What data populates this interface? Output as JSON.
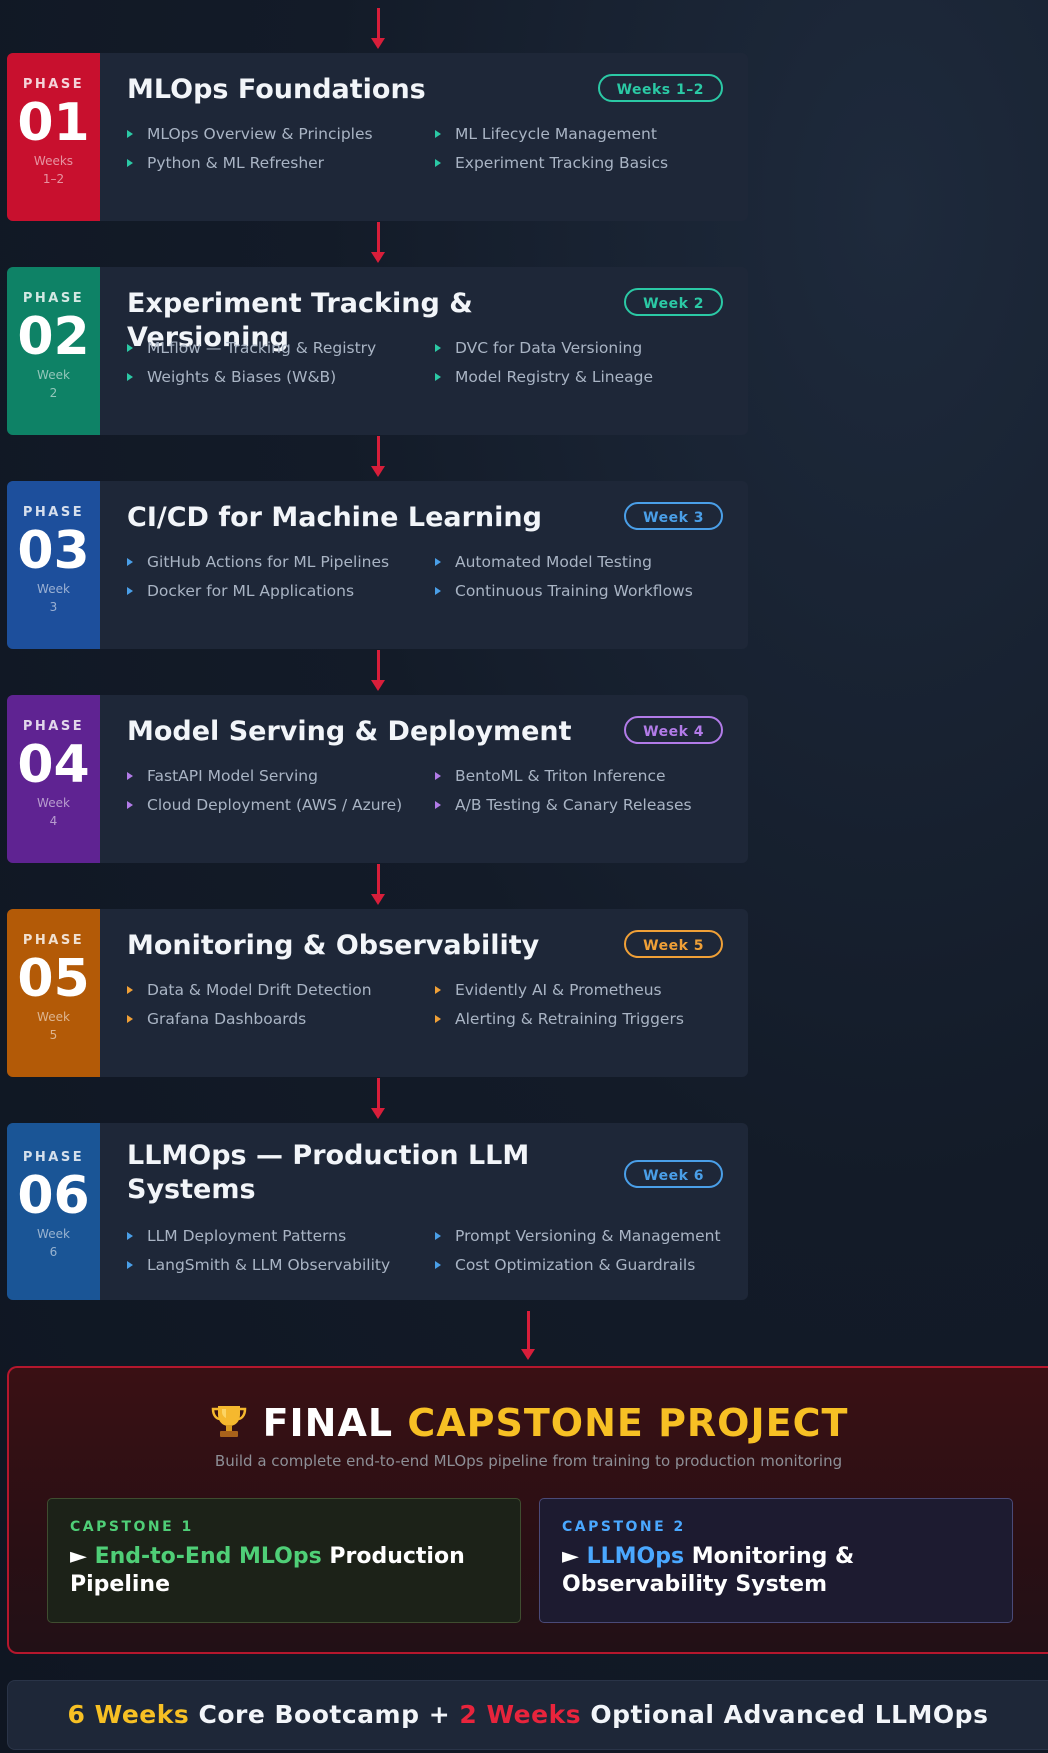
{
  "phases": [
    {
      "label": "PHASE",
      "number": "01",
      "side_week": "Weeks",
      "side_range": "1–2",
      "title": "MLOps Foundations",
      "badge": "Weeks 1–2",
      "color": "#c8102e",
      "accent": "#2bc9a5",
      "items": [
        "MLOps Overview & Principles",
        "ML Lifecycle Management",
        "Python & ML Refresher",
        "Experiment Tracking Basics"
      ]
    },
    {
      "label": "PHASE",
      "number": "02",
      "side_week": "Week",
      "side_range": "2",
      "title": "Experiment Tracking & Versioning",
      "badge": "Week 2",
      "color": "#0e8266",
      "accent": "#2bc9a5",
      "items": [
        "MLflow — Tracking & Registry",
        "DVC for Data Versioning",
        "Weights & Biases (W&B)",
        "Model Registry & Lineage"
      ]
    },
    {
      "label": "PHASE",
      "number": "03",
      "side_week": "Week",
      "side_range": "3",
      "title": "CI/CD for Machine Learning",
      "badge": "Week 3",
      "color": "#1d4f9c",
      "accent": "#4a9fe8",
      "items": [
        "GitHub Actions for ML Pipelines",
        "Automated Model Testing",
        "Docker for ML Applications",
        "Continuous Training Workflows"
      ]
    },
    {
      "label": "PHASE",
      "number": "04",
      "side_week": "Week",
      "side_range": "4",
      "title": "Model Serving & Deployment",
      "badge": "Week 4",
      "color": "#5f2392",
      "accent": "#b27be8",
      "items": [
        "FastAPI Model Serving",
        "BentoML & Triton Inference",
        "Cloud Deployment (AWS / Azure)",
        "A/B Testing & Canary Releases"
      ]
    },
    {
      "label": "PHASE",
      "number": "05",
      "side_week": "Week",
      "side_range": "5",
      "title": "Monitoring & Observability",
      "badge": "Week 5",
      "color": "#b35a07",
      "accent": "#f0a037",
      "items": [
        "Data & Model Drift Detection",
        "Evidently AI & Prometheus",
        "Grafana Dashboards",
        "Alerting & Retraining Triggers"
      ]
    },
    {
      "label": "PHASE",
      "number": "06",
      "side_week": "Week",
      "side_range": "6",
      "title": "LLMOps — Production LLM Systems",
      "badge": "Week 6",
      "color": "#1a5596",
      "accent": "#4a9fe8",
      "items": [
        "LLM Deployment Patterns",
        "Prompt Versioning & Management",
        "LangSmith & LLM Observability",
        "Cost Optimization & Guardrails"
      ]
    }
  ],
  "capstone": {
    "title_white": "FINAL",
    "title_yellow": "CAPSTONE PROJECT",
    "trophy_icon": "trophy-icon",
    "subtitle": "Build a complete end-to-end MLOps pipeline from training to production monitoring",
    "projects": [
      {
        "label": "CAPSTONE 1",
        "arrow": "►",
        "highlight": "End-to-End MLOps",
        "rest": "Production Pipeline",
        "accent": "#4fcf77"
      },
      {
        "label": "CAPSTONE 2",
        "arrow": "►",
        "highlight": "LLMOps",
        "rest": "Monitoring & Observability System",
        "accent": "#4aa8ff"
      }
    ]
  },
  "footer": {
    "num1": "6",
    "unit1": "Weeks",
    "text1": "Core Bootcamp",
    "plus": "+",
    "num2": "2",
    "unit2": "Weeks",
    "text2": "Optional Advanced LLMOps",
    "yellow": "#f7c024",
    "red": "#e8243c"
  }
}
